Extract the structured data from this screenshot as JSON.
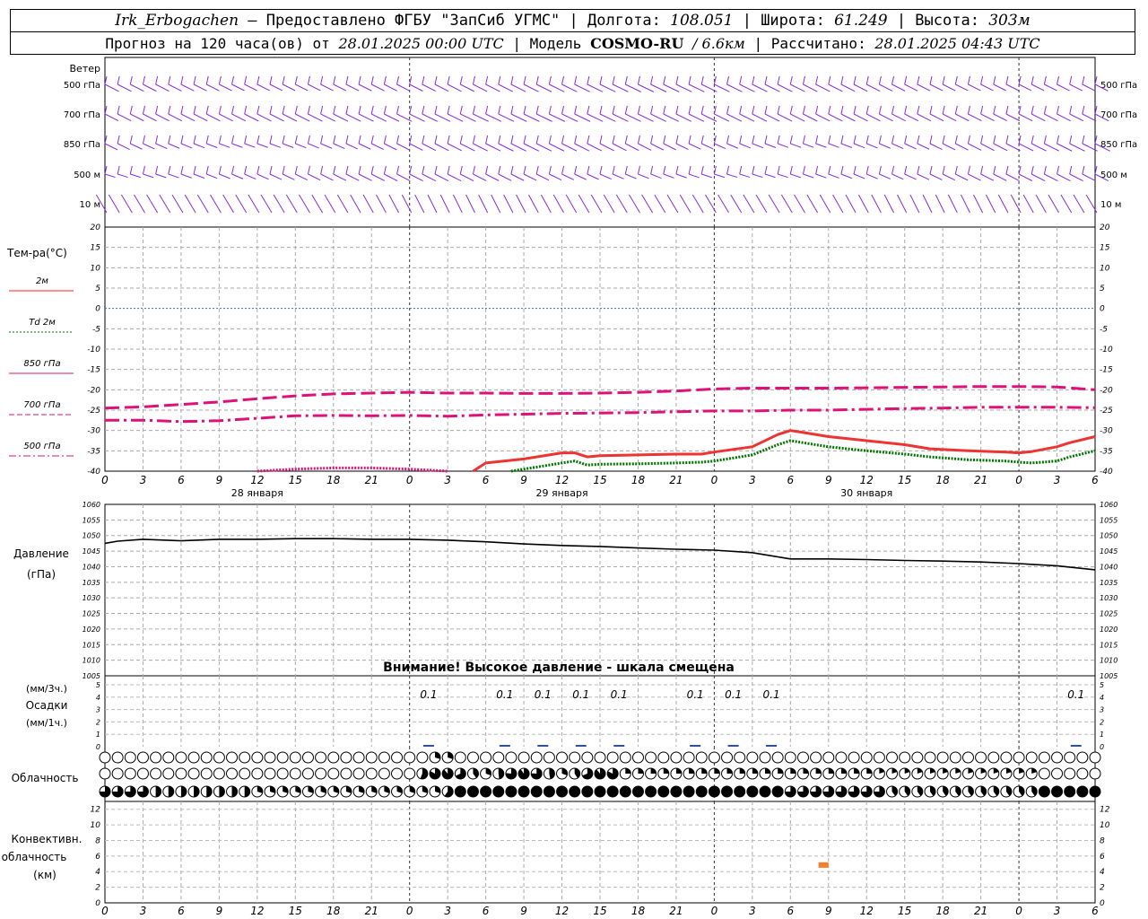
{
  "header": {
    "station": "Irk_Erbogachen",
    "provider": "– Предоставлено ФГБУ \"ЗапСиб УГМС\"",
    "lon_label": "Долгота:",
    "lon_value": "108.051",
    "lat_label": "Широта:",
    "lat_value": "61.249",
    "alt_label": "Высота:",
    "alt_value": "303м",
    "forecast_label": "Прогноз на 120 часа(ов) от",
    "forecast_start": "28.01.2025 00:00 UTC",
    "model_label": "Модель",
    "model_name": "COSMO-RU",
    "model_res": "/ 6.6км",
    "calc_label": "Рассчитано:",
    "calc_time": "28.01.2025 04:43 UTC"
  },
  "chart_data": [
    {
      "type": "wind-barbs",
      "title": "Ветер",
      "levels": [
        "500 гПа",
        "700 гПа",
        "850 гПа",
        "500 м",
        "10 м"
      ],
      "color": "#8a2be2"
    },
    {
      "type": "line",
      "ylabel": "Тем-ра(°C)",
      "ylim": [
        -40,
        20
      ],
      "yticks": [
        20,
        15,
        10,
        5,
        0,
        -5,
        -10,
        -15,
        -20,
        -25,
        -30,
        -35,
        -40
      ],
      "legend": [
        {
          "name": "2м",
          "color": "#ff2020",
          "dash": "solid"
        },
        {
          "name": "Td  2м",
          "color": "#007700",
          "dash": "dotted"
        },
        {
          "name": "850 гПа",
          "color": "#dd1177",
          "dash": "solid"
        },
        {
          "name": "700 гПа",
          "color": "#dd1177",
          "dash": "dashed"
        },
        {
          "name": "500 гПа",
          "color": "#dd1177",
          "dash": "dashdot"
        }
      ],
      "x_hours": [
        0,
        3,
        6,
        9,
        12,
        15,
        18,
        21,
        24,
        27,
        30,
        33,
        36,
        39,
        42,
        45,
        48,
        51,
        54,
        57,
        60,
        63,
        66,
        69,
        72,
        75,
        78
      ],
      "xtick_labels": [
        "0",
        "3",
        "6",
        "9",
        "12",
        "15",
        "18",
        "21",
        "0",
        "3",
        "6",
        "9",
        "12",
        "15",
        "18",
        "21",
        "0",
        "3",
        "6",
        "9",
        "12",
        "15",
        "18",
        "21",
        "0",
        "3",
        "6"
      ],
      "day_labels": [
        {
          "hour": 12,
          "text": "28 января"
        },
        {
          "hour": 36,
          "text": "29 января"
        },
        {
          "hour": 60,
          "text": "30 января"
        }
      ],
      "series": [
        {
          "name": "2м",
          "color": "#ee3333",
          "x": [
            29,
            30,
            33,
            36,
            37,
            38,
            39,
            42,
            45,
            47,
            48,
            51,
            53,
            54,
            55,
            57,
            60,
            63,
            65,
            68,
            71,
            72,
            73,
            75,
            76,
            78
          ],
          "y": [
            -40,
            -38,
            -37,
            -35.5,
            -35.5,
            -36.5,
            -36.2,
            -36,
            -35.8,
            -35.8,
            -35.3,
            -34,
            -31,
            -30,
            -30.5,
            -31.5,
            -32.5,
            -33.5,
            -34.5,
            -35,
            -35.3,
            -35.5,
            -35.2,
            -34,
            -33,
            -31.5
          ]
        },
        {
          "name": "Td  2м",
          "color": "#007700",
          "x": [
            32,
            33,
            36,
            37,
            38,
            39,
            42,
            45,
            47,
            48,
            51,
            53,
            54,
            55,
            57,
            60,
            63,
            65,
            68,
            71,
            72,
            73,
            75,
            76,
            78
          ],
          "y": [
            -40,
            -39.5,
            -38,
            -37.5,
            -38.5,
            -38.3,
            -38.2,
            -38,
            -37.8,
            -37.5,
            -36,
            -33.5,
            -32.5,
            -33,
            -34,
            -35,
            -35.8,
            -36.5,
            -37.2,
            -37.5,
            -37.8,
            -38,
            -37.5,
            -36.5,
            -35
          ]
        },
        {
          "name": "850 гПа",
          "color": "#dd1177",
          "x": [
            12,
            15,
            18,
            21,
            24,
            27
          ],
          "y": [
            -40,
            -39.5,
            -39.2,
            -39.2,
            -39.5,
            -40
          ]
        },
        {
          "name": "700 гПа",
          "color": "#dd1177",
          "x": [
            0,
            3,
            6,
            9,
            12,
            15,
            18,
            21,
            24,
            27,
            30,
            33,
            36,
            39,
            42,
            45,
            48,
            51,
            54,
            57,
            60,
            63,
            66,
            69,
            72,
            75,
            78
          ],
          "y": [
            -24.5,
            -24.2,
            -23.6,
            -23,
            -22.2,
            -21.5,
            -21,
            -20.8,
            -20.6,
            -20.8,
            -20.8,
            -20.9,
            -20.9,
            -20.8,
            -20.6,
            -20.3,
            -19.8,
            -19.6,
            -19.6,
            -19.6,
            -19.5,
            -19.4,
            -19.3,
            -19.2,
            -19.2,
            -19.3,
            -20
          ]
        },
        {
          "name": "500 гПа",
          "color": "#dd1177",
          "x": [
            0,
            3,
            6,
            9,
            12,
            15,
            18,
            21,
            24,
            27,
            30,
            33,
            36,
            39,
            42,
            45,
            48,
            51,
            54,
            57,
            60,
            63,
            66,
            69,
            72,
            75,
            78
          ],
          "y": [
            -27.5,
            -27.5,
            -27.8,
            -27.6,
            -27,
            -26.4,
            -26.3,
            -26.4,
            -26.3,
            -26.5,
            -26.2,
            -26,
            -25.8,
            -25.7,
            -25.6,
            -25.4,
            -25.2,
            -25.2,
            -25,
            -25,
            -24.8,
            -24.6,
            -24.5,
            -24.3,
            -24.3,
            -24.3,
            -24.4
          ]
        }
      ]
    },
    {
      "type": "line",
      "ylabel": "Давление",
      "ylabel2": "(гПа)",
      "ylim": [
        1005,
        1060
      ],
      "yticks": [
        1060,
        1055,
        1050,
        1045,
        1040,
        1035,
        1030,
        1025,
        1020,
        1015,
        1010,
        1005
      ],
      "annotation": "Внимание! Высокое давление - шкала смещена",
      "series": [
        {
          "name": "pressure",
          "color": "#000000",
          "x": [
            0,
            1,
            3,
            6,
            9,
            12,
            15,
            18,
            21,
            24,
            27,
            30,
            33,
            36,
            39,
            42,
            45,
            48,
            51,
            54,
            57,
            60,
            63,
            66,
            69,
            72,
            75,
            78
          ],
          "y": [
            1047.5,
            1048.2,
            1048.8,
            1048.3,
            1048.8,
            1048.8,
            1049,
            1049,
            1048.8,
            1048.8,
            1048.5,
            1048,
            1047.3,
            1046.8,
            1046.5,
            1046,
            1045.6,
            1045.3,
            1044.5,
            1042.5,
            1042.5,
            1042.3,
            1042,
            1041.8,
            1041.5,
            1041,
            1040.3,
            1039
          ]
        }
      ]
    },
    {
      "type": "bar",
      "ylabel_top": "(мм/3ч.)",
      "ylabel": "Осадки",
      "ylabel_bottom": "(мм/1ч.)",
      "ylim": [
        0,
        5
      ],
      "yticks": [
        "5",
        "4",
        "3",
        "2",
        "1",
        "0"
      ],
      "labels": [
        {
          "x": 25.5,
          "text": "0.1"
        },
        {
          "x": 31.5,
          "text": "0.1"
        },
        {
          "x": 34.5,
          "text": "0.1"
        },
        {
          "x": 37.5,
          "text": "0.1"
        },
        {
          "x": 40.5,
          "text": "0.1"
        },
        {
          "x": 46.5,
          "text": "0.1"
        },
        {
          "x": 49.5,
          "text": "0.1"
        },
        {
          "x": 52.5,
          "text": "0.1"
        },
        {
          "x": 76.5,
          "text": "0.1"
        }
      ]
    },
    {
      "type": "cloud-symbols",
      "ylabel": "Облачность",
      "rows": 3
    },
    {
      "type": "bar",
      "ylabel": "Конвективн.",
      "ylabel2": "облачность",
      "ylabel3": "(км)",
      "ylim": [
        0,
        13
      ],
      "yticks": [
        12,
        10,
        8,
        6,
        4,
        2,
        0
      ],
      "blocks": [
        {
          "x0": 56,
          "x1": 57,
          "base": 4.5,
          "top": 5.2,
          "color": "#f08030"
        }
      ]
    }
  ]
}
